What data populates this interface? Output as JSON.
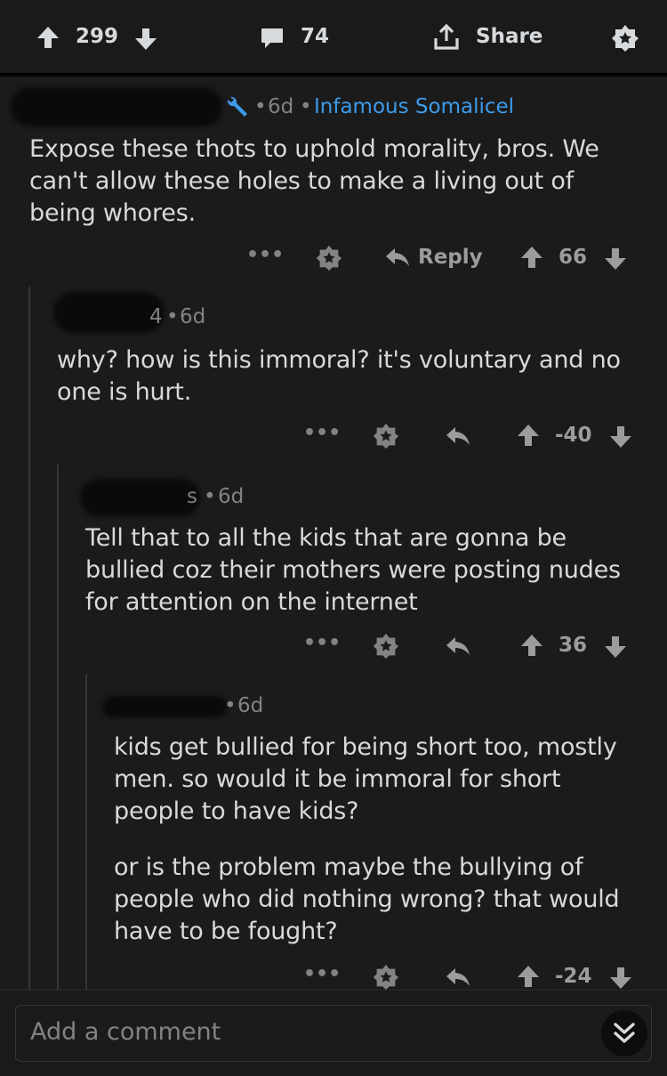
{
  "post_bar": {
    "upvotes": "299",
    "comments": "74",
    "share_label": "Share"
  },
  "comments": [
    {
      "age": "6d",
      "flair": "Infamous Somalicel",
      "body": [
        "Expose these thots to uphold morality, bros. We",
        "can't allow these holes to make a living out of",
        "being whores."
      ],
      "reply_label": "Reply",
      "score": "66"
    },
    {
      "age": "6d",
      "body": [
        "why? how is this immoral? it's voluntary and no",
        "one is hurt."
      ],
      "score": "-40"
    },
    {
      "age": "6d",
      "body": [
        "Tell that to all the kids that are gonna be",
        "bullied coz their mothers were posting nudes",
        "for attention on the internet"
      ],
      "score": "36"
    },
    {
      "age": "6d",
      "body": [
        "kids get bullied for being short too, mostly",
        "men. so would it be immoral for short",
        "people to have kids?"
      ],
      "body2": [
        "or is the problem maybe the bullying of",
        "people who did nothing wrong? that would",
        "have to be fought?"
      ],
      "score": "-24"
    }
  ],
  "composer": {
    "placeholder": "Add a comment"
  },
  "colors": {
    "background": "#1b1b1c",
    "flair": "#3d9bea",
    "mod_icon": "#3d9bea",
    "thread_line": "#343536"
  },
  "icons": [
    "upvote-icon",
    "downvote-icon",
    "comment-icon",
    "share-icon",
    "award-icon",
    "more-icon",
    "reply-icon",
    "mod-wrench-icon",
    "collapse-chevrons-icon"
  ]
}
